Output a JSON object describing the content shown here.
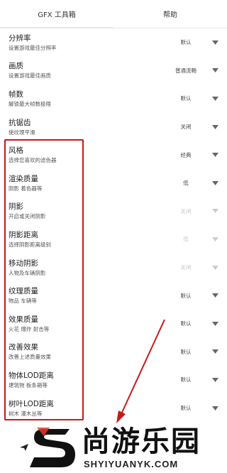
{
  "tabs": [
    {
      "label": "GFX 工具箱"
    },
    {
      "label": "帮助"
    }
  ],
  "settings": [
    {
      "title": "分辨率",
      "subtitle": "设置游戏最佳分辨率",
      "value": "默认",
      "disabled": false
    },
    {
      "title": "画质",
      "subtitle": "设置游戏最佳画质",
      "value": "普通流畅",
      "disabled": false
    },
    {
      "title": "帧数",
      "subtitle": "解锁最大帧数极限",
      "value": "默认",
      "disabled": false
    },
    {
      "title": "抗锯齿",
      "subtitle": "使纹理平滑",
      "value": "关闭",
      "disabled": false
    },
    {
      "title": "风格",
      "subtitle": "选择您喜欢的滤色器",
      "value": "经典",
      "disabled": false
    },
    {
      "title": "渲染质量",
      "subtitle": "阴影 着色器等",
      "value": "低",
      "disabled": false
    },
    {
      "title": "阴影",
      "subtitle": "开启或关闭阴影",
      "value": "关闭",
      "disabled": true
    },
    {
      "title": "阴影距离",
      "subtitle": "选择阴影距离级别",
      "value": "低",
      "disabled": true
    },
    {
      "title": "移动阴影",
      "subtitle": "人物及车辆阴影",
      "value": "关闭",
      "disabled": true
    },
    {
      "title": "纹理质量",
      "subtitle": "物品 车辆等",
      "value": "默认",
      "disabled": false
    },
    {
      "title": "效果质量",
      "subtitle": "火花 爆炸 射击等",
      "value": "默认",
      "disabled": false
    },
    {
      "title": "改善效果",
      "subtitle": "改善上述质量效果",
      "value": "默认",
      "disabled": false
    },
    {
      "title": "物体LOD距离",
      "subtitle": "建筑物 板条箱等",
      "value": "默认",
      "disabled": false
    },
    {
      "title": "树叶LOD距离",
      "subtitle": "树木 灌木丛等",
      "value": "默认",
      "disabled": false
    }
  ],
  "colors": {
    "highlight": "#c41a1a",
    "caret": "#666666",
    "caret_disabled": "#cccccc"
  },
  "watermark": {
    "logo_icon": "s-logo-icon",
    "text_cn": "尚游乐园",
    "text_en": "SHYIYUANYK.COM"
  }
}
